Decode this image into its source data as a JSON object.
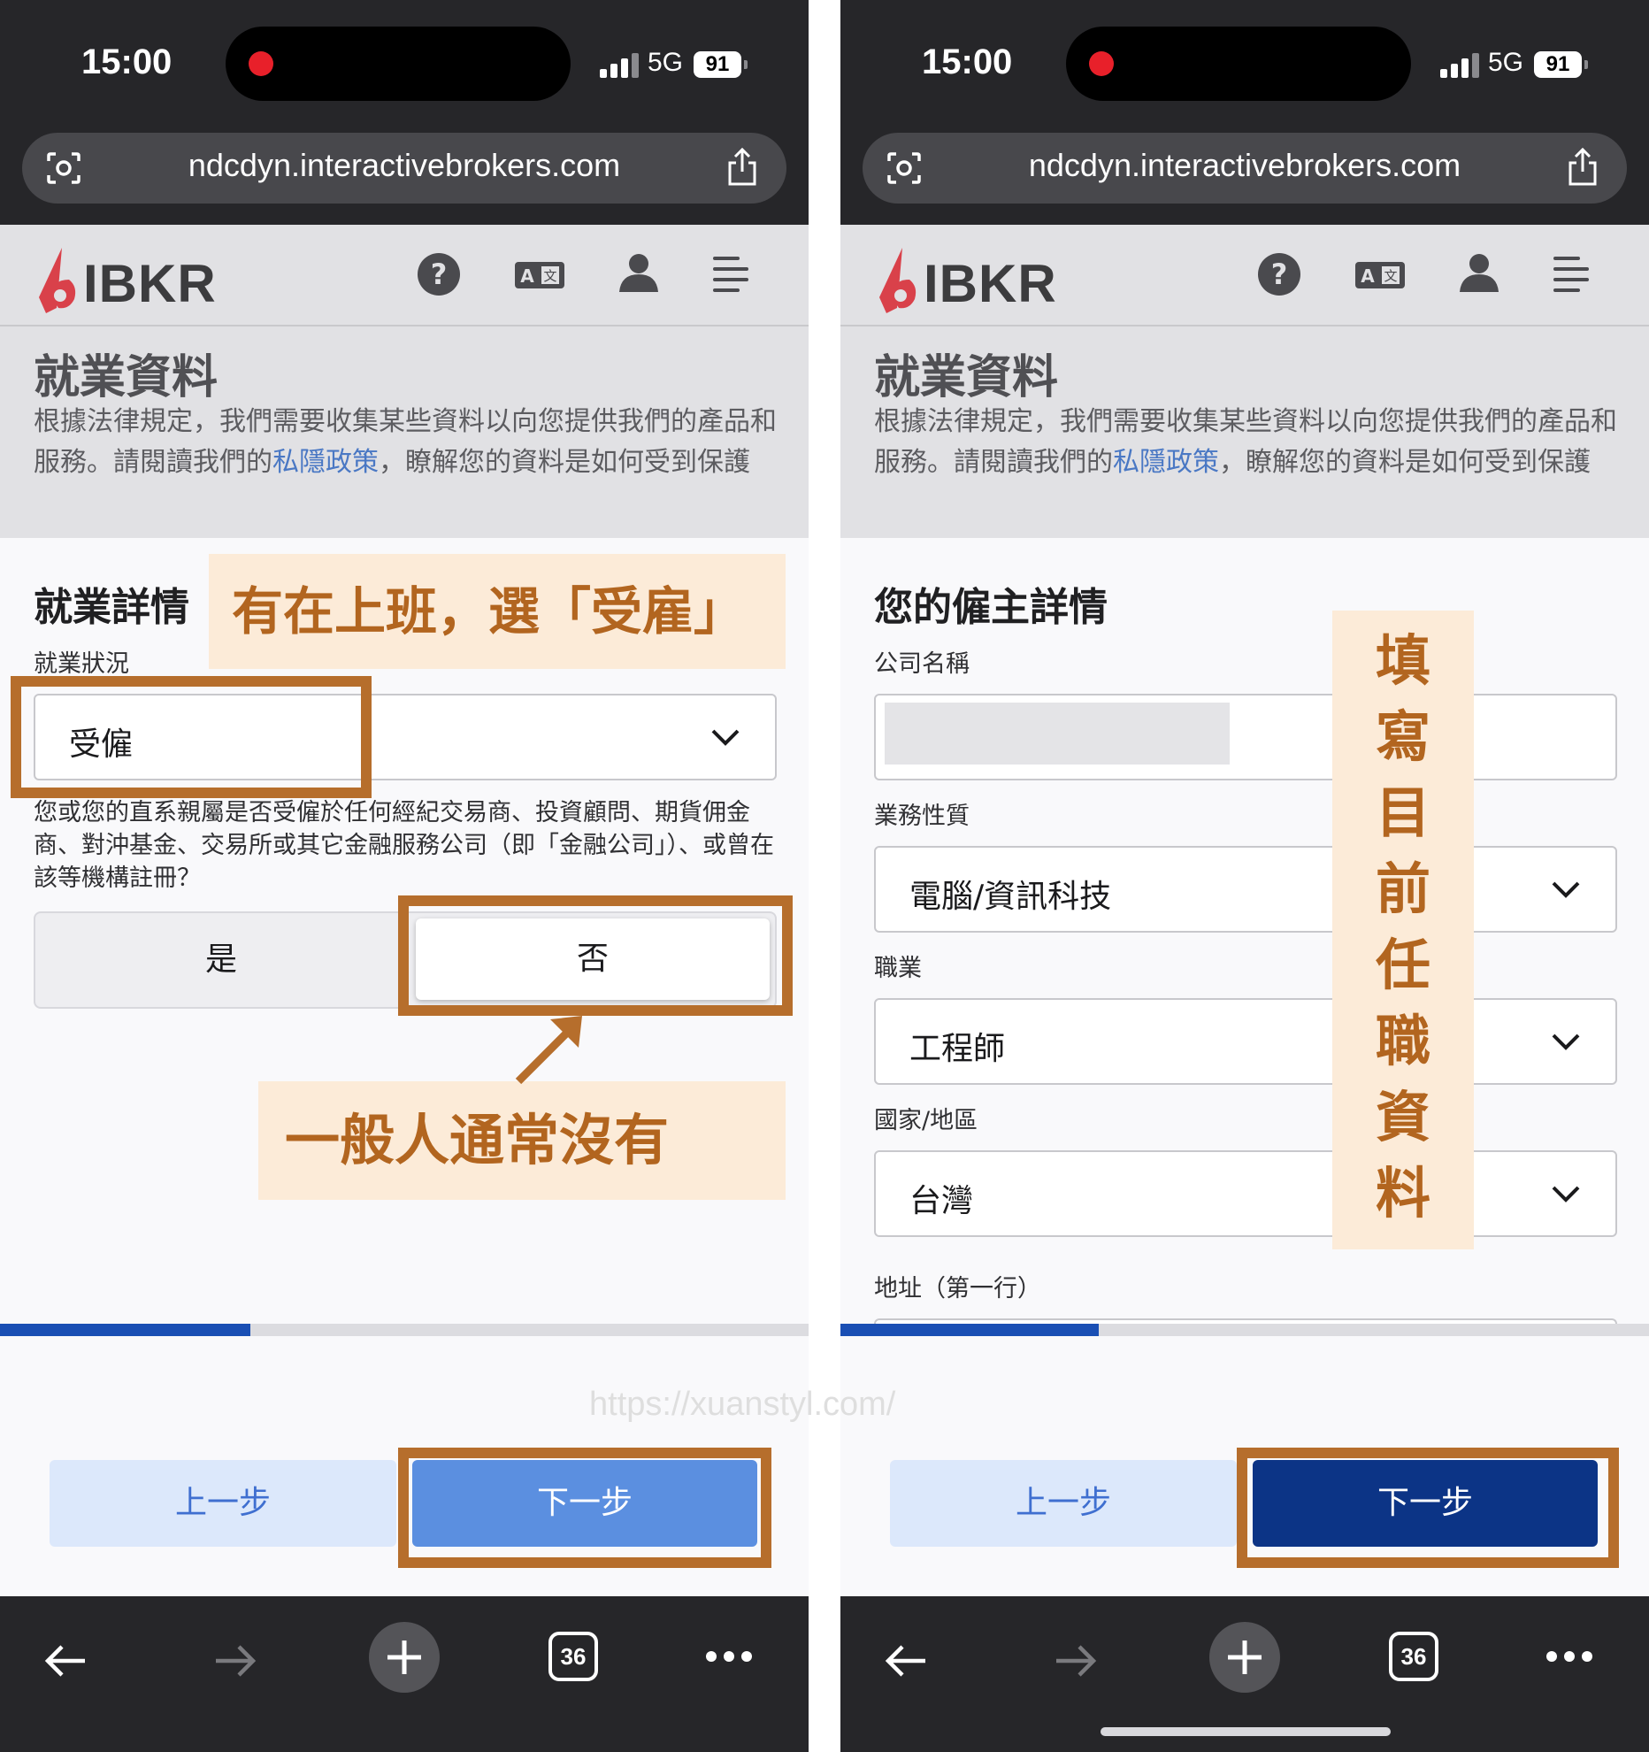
{
  "status_bar": {
    "time": "15:00",
    "network": "5G",
    "battery": "91"
  },
  "browser": {
    "url": "ndcdyn.interactivebrokers.com",
    "tab_count": "36"
  },
  "header": {
    "logo_text": "IBKR"
  },
  "page": {
    "title": "就業資料",
    "intro_before": "根據法律規定，我們需要收集某些資料以向您提供我們的產品和服務。請閱讀我們的",
    "privacy_link": "私隱政策",
    "intro_after": "，瞭解您的資料是如何受到保護"
  },
  "left": {
    "section_title": "就業詳情",
    "status_label": "就業狀況",
    "status_value": "受僱",
    "question": "您或您的直系親屬是否受僱於任何經紀交易商、投資顧問、期貨佣金商、對沖基金、交易所或其它金融服務公司（即「金融公司」）、或曾在該等機構註冊？",
    "yes_label": "是",
    "no_label": "否",
    "progress": 0.31,
    "prev_label": "上一步",
    "next_label": "下一步",
    "next_color": "#5b8fe0"
  },
  "right": {
    "section_title": "您的僱主詳情",
    "company_label": "公司名稱",
    "business_label": "業務性質",
    "business_value": "電腦/資訊科技",
    "occupation_label": "職業",
    "occupation_value": "工程師",
    "country_label": "國家/地區",
    "country_value": "台灣",
    "address_label": "地址（第一行）",
    "progress": 0.32,
    "prev_label": "上一步",
    "next_label": "下一步",
    "next_color": "#0c3486"
  },
  "annotations": {
    "left_top": "有在上班，選「受雇」",
    "left_bottom": "一般人通常沒有",
    "right_vertical": [
      "填",
      "寫",
      "目",
      "前",
      "任",
      "職",
      "資",
      "料"
    ],
    "accent_color": "#b66e2c"
  },
  "watermark": "https://xuanstyl.com/"
}
